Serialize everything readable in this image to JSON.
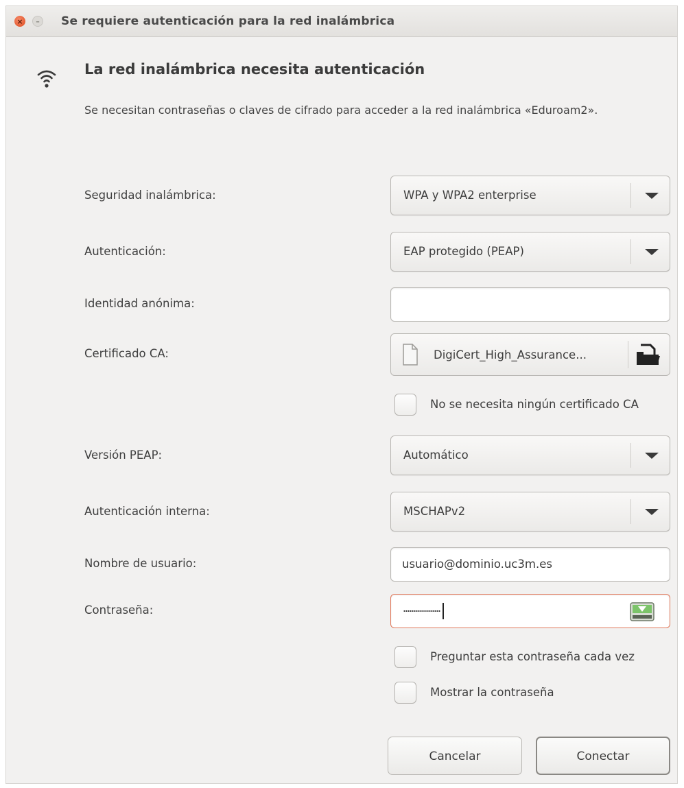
{
  "window": {
    "title": "Se requiere autenticación para la red inalámbrica"
  },
  "header": {
    "heading": "La red inalámbrica necesita autenticación",
    "description": "Se necesitan contraseñas o claves de cifrado para acceder a la red inalámbrica «Eduroam2»."
  },
  "form": {
    "security": {
      "label": "Seguridad inalámbrica:",
      "value": "WPA y WPA2 enterprise"
    },
    "authentication": {
      "label": "Autenticación:",
      "value": "EAP protegido (PEAP)"
    },
    "anonymous_identity": {
      "label": "Identidad anónima:",
      "value": ""
    },
    "ca_certificate": {
      "label": "Certificado CA:",
      "value": "DigiCert_High_Assurance..."
    },
    "no_ca_needed": {
      "label": "No se necesita ningún certificado CA",
      "checked": false
    },
    "peap_version": {
      "label": "Versión PEAP:",
      "value": "Automático"
    },
    "inner_auth": {
      "label": "Autenticación interna:",
      "value": "MSCHAPv2"
    },
    "username": {
      "label": "Nombre de usuario:",
      "value": "usuario@dominio.uc3m.es"
    },
    "password": {
      "label": "Contraseña:"
    },
    "ask_every_time": {
      "label": "Preguntar esta contraseña cada vez",
      "checked": false
    },
    "show_password": {
      "label": "Mostrar la contraseña",
      "checked": false
    }
  },
  "buttons": {
    "cancel": "Cancelar",
    "connect": "Conectar"
  },
  "icons": {
    "close": "close-icon",
    "minimize": "minimize-icon",
    "wifi": "wifi-icon",
    "file": "file-icon",
    "open": "open-file-icon",
    "password_store": "password-store-icon"
  },
  "colors": {
    "close_button": "#df4a1c",
    "error_border": "#e0785a"
  }
}
